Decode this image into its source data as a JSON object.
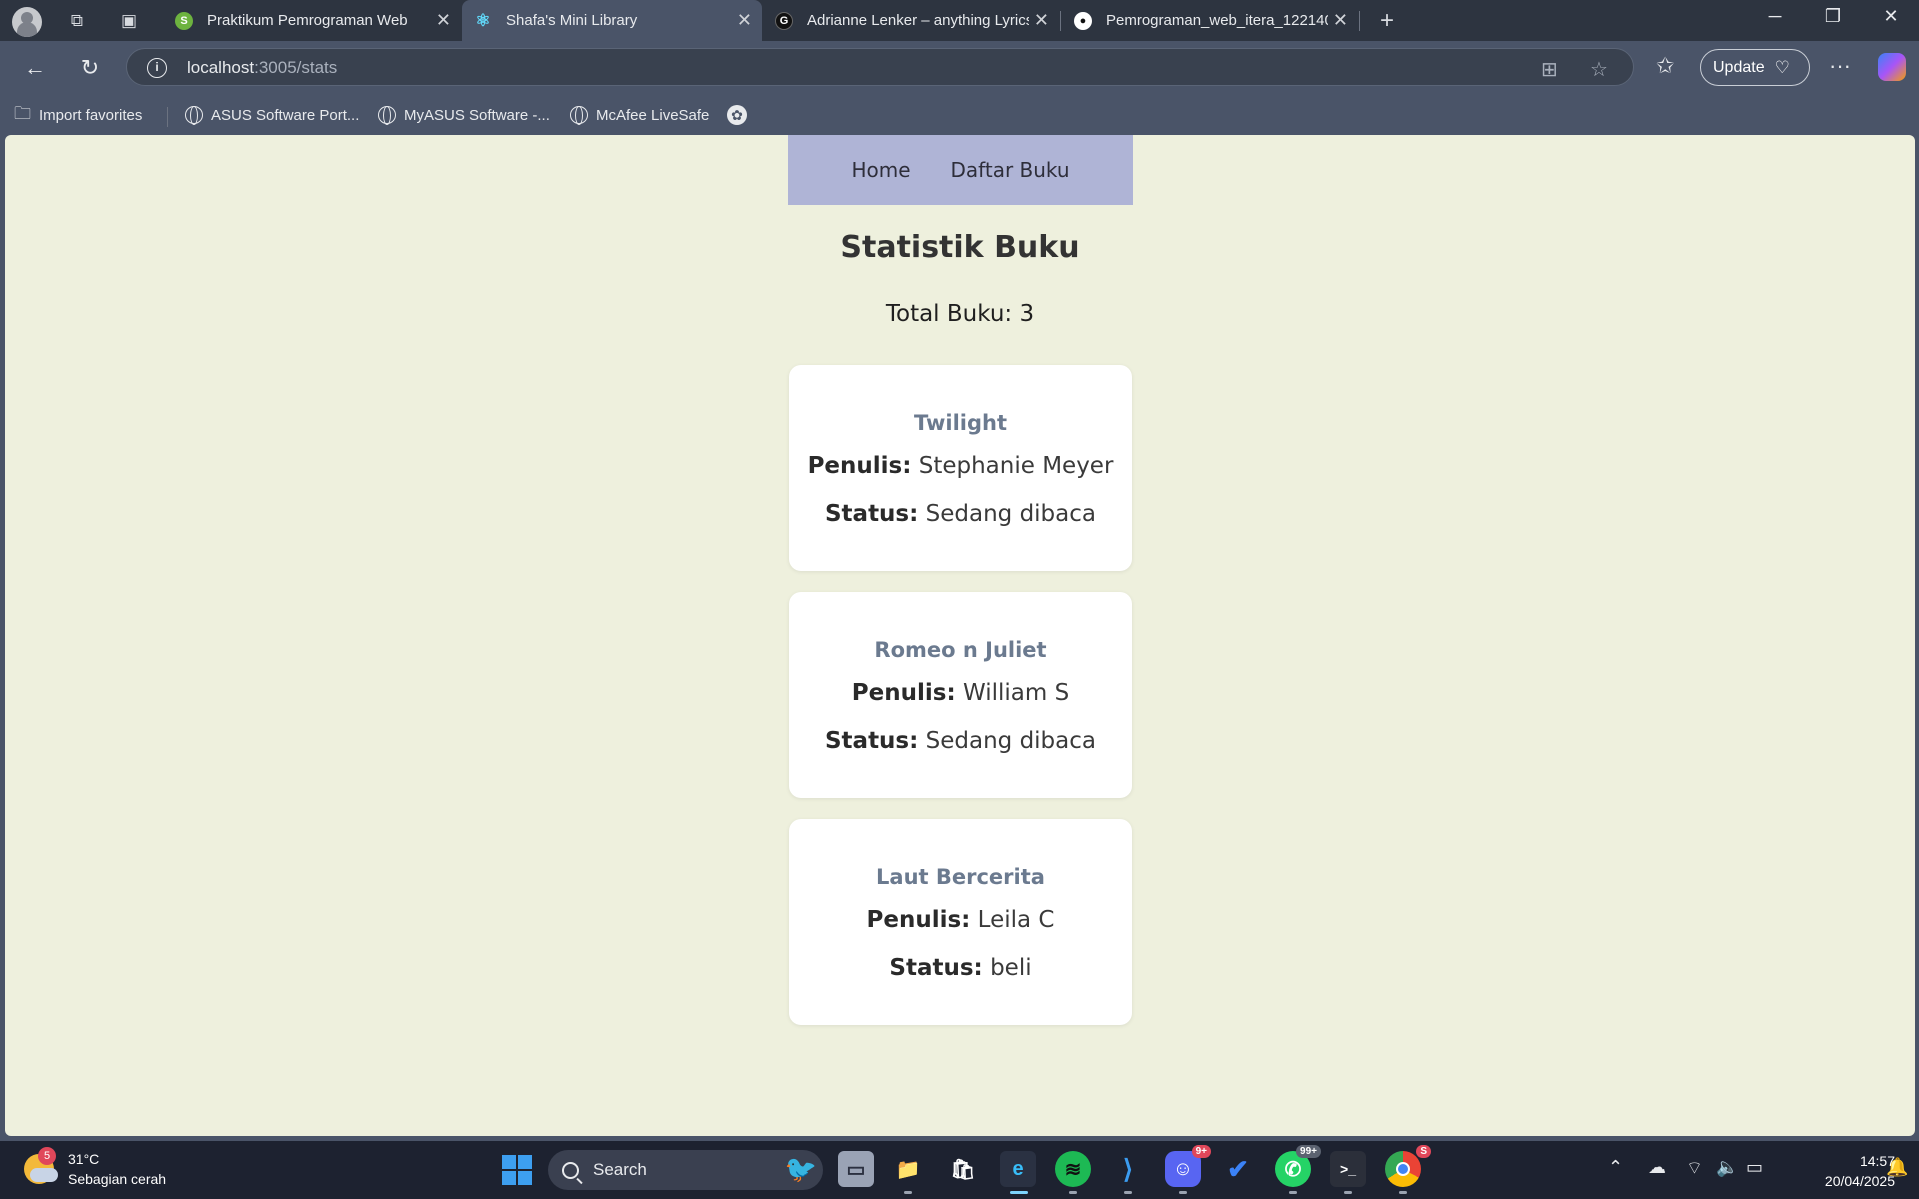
{
  "browser": {
    "tabs": [
      {
        "title": "Praktikum Pemrograman Web",
        "favicon": "spring-icon",
        "color": "#6db33f"
      },
      {
        "title": "Shafa's Mini Library",
        "favicon": "react-icon",
        "color": "#61dafb",
        "active": true
      },
      {
        "title": "Adrianne Lenker – anything Lyrics",
        "favicon": "genius-icon",
        "color": "#111111"
      },
      {
        "title": "Pemrograman_web_itera_122140",
        "favicon": "github-icon",
        "color": "#ffffff"
      }
    ],
    "url_host": "localhost",
    "url_path": ":3005/stats",
    "update_label": "Update",
    "bookmarks": [
      {
        "label": "Import favorites"
      },
      {
        "label": "ASUS Software Port..."
      },
      {
        "label": "MyASUS Software -..."
      },
      {
        "label": "McAfee LiveSafe"
      }
    ]
  },
  "page": {
    "nav": {
      "home": "Home",
      "books": "Daftar Buku"
    },
    "title": "Statistik Buku",
    "total": "Total Buku: 3",
    "labels": {
      "author": "Penulis:",
      "status": "Status:"
    },
    "books": [
      {
        "title": "Twilight",
        "author": "Stephanie Meyer",
        "status": "Sedang dibaca"
      },
      {
        "title": "Romeo n Juliet",
        "author": "William S",
        "status": "Sedang dibaca"
      },
      {
        "title": "Laut Bercerita",
        "author": "Leila C",
        "status": "beli"
      }
    ]
  },
  "taskbar": {
    "weather_badge": "5",
    "temperature": "31°C",
    "condition": "Sebagian cerah",
    "search_label": "Search",
    "discord_badge": "9+",
    "whatsapp_badge": "99+",
    "chrome_badge": "S",
    "time": "14:57",
    "date": "20/04/2025"
  }
}
